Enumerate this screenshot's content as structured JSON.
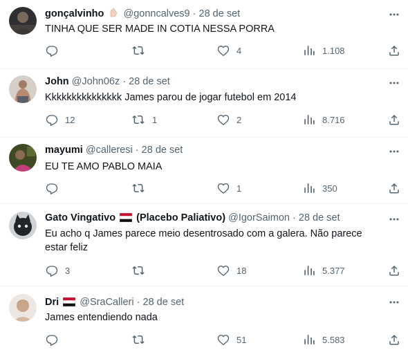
{
  "tweets": [
    {
      "name": "gonçalvinho",
      "handle": "@gonncalves9",
      "separator": "·",
      "time": "28 de set",
      "text": "TINHA QUE SER MADE IN COTIA NESSA PORRA",
      "replies": "",
      "retweets": "",
      "likes": "4",
      "views": "1.108",
      "avatar_color": "#3b3a3c"
    },
    {
      "name": "John",
      "handle": "@John06z",
      "separator": "·",
      "time": "28 de set",
      "text": "Kkkkkkkkkkkkkkk James parou de jogar futebol em 2014",
      "replies": "12",
      "retweets": "1",
      "likes": "2",
      "views": "8.716",
      "avatar_color": "#b5a59a"
    },
    {
      "name": "mayumi",
      "handle": "@calleresi",
      "separator": "·",
      "time": "28 de set",
      "text": "EU TE AMO PABLO MAIA",
      "replies": "",
      "retweets": "",
      "likes": "1",
      "views": "350",
      "avatar_color": "#4a5a2a"
    },
    {
      "name": "Gato Vingativo",
      "name_suffix": "(Placebo Paliativo)",
      "handle": "@IgorSaimon",
      "separator": "·",
      "time": "28 de set",
      "text": "Eu acho q James parece meio desentrosado com a galera. Não parece estar feliz",
      "replies": "3",
      "retweets": "",
      "likes": "18",
      "views": "5.377",
      "avatar_color": "#2c2f33"
    },
    {
      "name": "Dri",
      "handle": "@SraCalleri",
      "separator": "·",
      "time": "28 de set",
      "text": "James entendiendo nada",
      "replies": "",
      "retweets": "",
      "likes": "51",
      "views": "5.583",
      "avatar_color": "#d9c2ad"
    }
  ]
}
